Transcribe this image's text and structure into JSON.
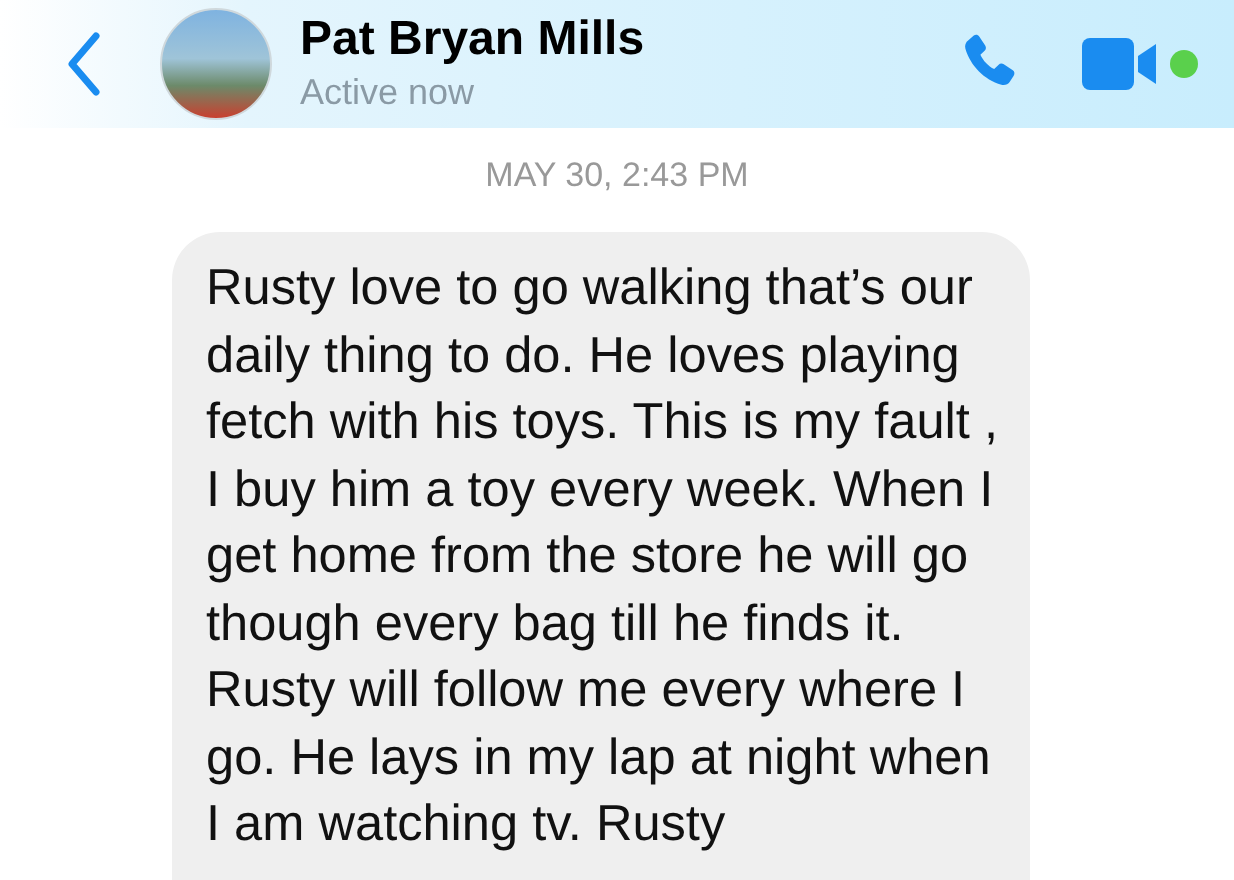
{
  "header": {
    "contact_name": "Pat Bryan Mills",
    "status": "Active now",
    "online": true
  },
  "timestamp": "MAY 30, 2:43 PM",
  "messages": [
    {
      "kind": "incoming",
      "text": "Rusty love to go walking that’s our daily thing to do. He loves playing fetch with his toys. This is my fault , I buy him a toy every week. When I get home from the store he will go though every bag till he finds it. Rusty will follow me every where I go. He lays in my lap at night when I am watching tv. Rusty"
    }
  ]
}
